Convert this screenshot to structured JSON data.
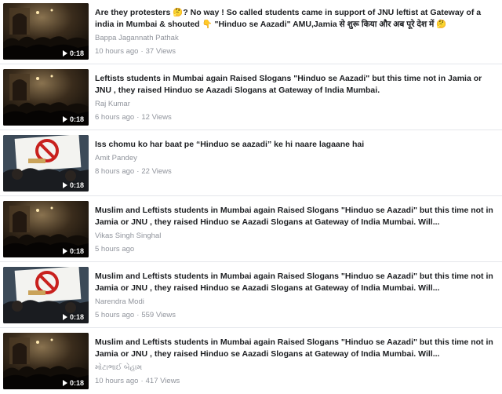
{
  "videos": [
    {
      "thumb": "gateway-night",
      "duration": "0:18",
      "title": "Are they protesters 🤔? No way ! So called students came in support of JNU leftist at Gateway of a india in Mumbai & shouted 👇 \"Hinduo se Aazadi\" AMU,Jamia से शुरू किया और अब पूरे देश में 🤔",
      "author": "Bappa Jagannath Pathak",
      "time": "10 hours ago",
      "views": "37 Views"
    },
    {
      "thumb": "gateway-night",
      "duration": "0:18",
      "title": "Leftists students in Mumbai again Raised Slogans \"Hinduo se Aazadi\" but this time not in Jamia or JNU , they raised Hinduo se Aazadi Slogans at Gateway of India Mumbai.",
      "author": "Raj Kumar",
      "time": "6 hours ago",
      "views": "12 Views"
    },
    {
      "thumb": "protest-placard",
      "duration": "0:18",
      "title": "Iss chomu ko har baat pe “Hinduo se aazadi” ke hi naare lagaane hai",
      "author": "Amit Pandey",
      "time": "8 hours ago",
      "views": "22 Views"
    },
    {
      "thumb": "gateway-night",
      "duration": "0:18",
      "title": "Muslim and Leftists students in Mumbai again Raised Slogans \"Hinduo se Aazadi\" but this time not in Jamia or JNU , they raised Hinduo se Aazadi Slogans at Gateway of India Mumbai. Will...",
      "author": "Vikas Singh Singhal",
      "time": "5 hours ago",
      "views": ""
    },
    {
      "thumb": "protest-placard",
      "duration": "0:18",
      "title": "Muslim and Leftists students in Mumbai again Raised Slogans \"Hinduo se Aazadi\" but this time not in Jamia or JNU , they raised Hinduo se Aazadi Slogans at Gateway of India Mumbai. Will...",
      "author": "Narendra Modi",
      "time": "5 hours ago",
      "views": "559 Views"
    },
    {
      "thumb": "gateway-night",
      "duration": "0:18",
      "title": "Muslim and Leftists students in Mumbai again Raised Slogans \"Hinduo se Aazadi\" but this time not in Jamia or JNU , they raised Hinduo se Aazadi Slogans at Gateway of India Mumbai. Will...",
      "author": "મોટાભાઈ બેહામ",
      "time": "10 hours ago",
      "views": "417 Views"
    }
  ],
  "colors": {
    "title": "#1c1e21",
    "meta": "#90949c"
  }
}
